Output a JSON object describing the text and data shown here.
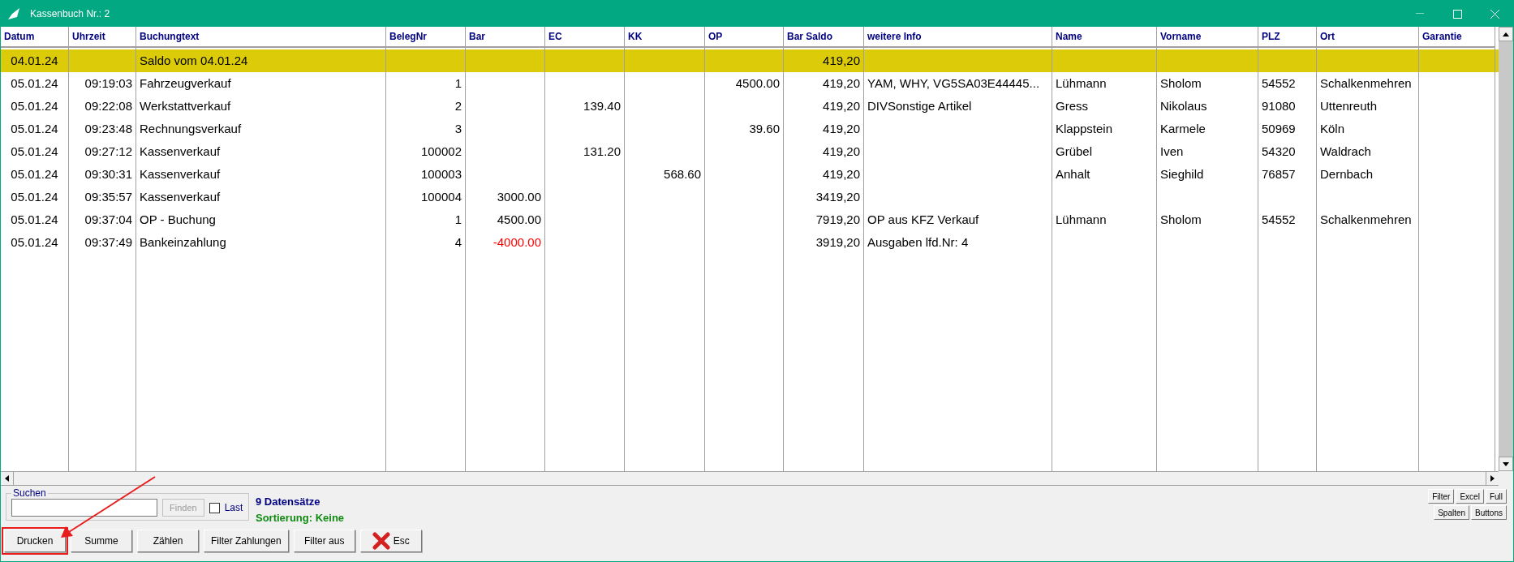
{
  "window": {
    "title": "Kassenbuch Nr.: 2"
  },
  "table": {
    "columns": [
      {
        "label": "Datum",
        "kind": "date"
      },
      {
        "label": "Uhrzeit",
        "kind": "number"
      },
      {
        "label": "Buchungtext",
        "kind": "text"
      },
      {
        "label": "BelegNr",
        "kind": "number"
      },
      {
        "label": "Bar",
        "kind": "number"
      },
      {
        "label": "EC",
        "kind": "number"
      },
      {
        "label": "KK",
        "kind": "number"
      },
      {
        "label": "OP",
        "kind": "number"
      },
      {
        "label": "Bar Saldo",
        "kind": "number"
      },
      {
        "label": "weitere Info",
        "kind": "text"
      },
      {
        "label": "Name",
        "kind": "text"
      },
      {
        "label": "Vorname",
        "kind": "text"
      },
      {
        "label": "PLZ",
        "kind": "text"
      },
      {
        "label": "Ort",
        "kind": "text"
      },
      {
        "label": "Garantie",
        "kind": "text"
      }
    ],
    "rows": [
      {
        "selected": true,
        "cells": [
          "04.01.24",
          null,
          "Saldo vom 04.01.24",
          null,
          null,
          null,
          null,
          null,
          "419,20",
          null,
          null,
          null,
          null,
          null,
          null
        ]
      },
      {
        "selected": false,
        "cells": [
          "05.01.24",
          "09:19:03",
          "Fahrzeugverkauf",
          "1",
          null,
          null,
          null,
          "4500.00",
          "419,20",
          "YAM, WHY, VG5SA03E44445...",
          "Lühmann",
          "Sholom",
          "54552",
          "Schalkenmehren",
          null
        ]
      },
      {
        "selected": false,
        "cells": [
          "05.01.24",
          "09:22:08",
          "Werkstattverkauf",
          "2",
          null,
          "139.40",
          null,
          null,
          "419,20",
          "DIVSonstige Artikel",
          "Gress",
          "Nikolaus",
          "91080",
          "Uttenreuth",
          null
        ]
      },
      {
        "selected": false,
        "cells": [
          "05.01.24",
          "09:23:48",
          "Rechnungsverkauf",
          "3",
          null,
          null,
          null,
          "39.60",
          "419,20",
          null,
          "Klappstein",
          "Karmele",
          "50969",
          "Köln",
          null
        ]
      },
      {
        "selected": false,
        "cells": [
          "05.01.24",
          "09:27:12",
          "Kassenverkauf",
          "100002",
          null,
          "131.20",
          null,
          null,
          "419,20",
          null,
          "Grübel",
          "Iven",
          "54320",
          "Waldrach",
          null
        ]
      },
      {
        "selected": false,
        "cells": [
          "05.01.24",
          "09:30:31",
          "Kassenverkauf",
          "100003",
          null,
          null,
          "568.60",
          null,
          "419,20",
          null,
          "Anhalt",
          "Sieghild",
          "76857",
          "Dernbach",
          null
        ]
      },
      {
        "selected": false,
        "cells": [
          "05.01.24",
          "09:35:57",
          "Kassenverkauf",
          "100004",
          "3000.00",
          null,
          null,
          null,
          "3419,20",
          null,
          null,
          null,
          null,
          null,
          null
        ]
      },
      {
        "selected": false,
        "cells": [
          "05.01.24",
          "09:37:04",
          "OP - Buchung",
          "1",
          "4500.00",
          null,
          null,
          null,
          "7919,20",
          "OP aus KFZ Verkauf",
          "Lühmann",
          "Sholom",
          "54552",
          "Schalkenmehren",
          null
        ]
      },
      {
        "selected": false,
        "negative_bar": true,
        "cells": [
          "05.01.24",
          "09:37:49",
          "Bankeinzahlung",
          "4",
          "-4000.00",
          null,
          null,
          null,
          "3919,20",
          "Ausgaben lfd.Nr: 4",
          null,
          null,
          null,
          null,
          null
        ]
      }
    ]
  },
  "search": {
    "label": "Suchen",
    "find_button": {
      "label": "Finden",
      "disabled": true
    },
    "last": {
      "label": "Last",
      "checked": false
    }
  },
  "status": {
    "count": "9 Datensätze",
    "sorting": "Sortierung: Keine"
  },
  "buttons": [
    {
      "label": "Drucken"
    },
    {
      "label": "Summe"
    },
    {
      "label": "Zählen"
    },
    {
      "label": "Filter Zahlungen"
    },
    {
      "label": "Filter aus"
    },
    {
      "label": "Esc"
    }
  ],
  "annotation": {
    "frame_on_first_button": true,
    "arrow": true
  },
  "side_buttons": [
    [
      "Filter",
      "Excel",
      "Full"
    ],
    [
      "Spalten",
      "Buttons"
    ]
  ]
}
